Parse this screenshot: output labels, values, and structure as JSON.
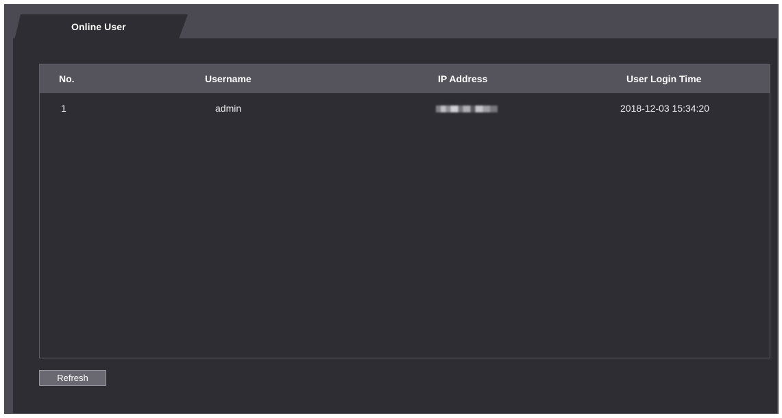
{
  "tab": {
    "label": "Online User"
  },
  "table": {
    "headers": {
      "no": "No.",
      "username": "Username",
      "ip": "IP Address",
      "login_time": "User Login Time"
    },
    "rows": [
      {
        "no": "1",
        "username": "admin",
        "ip": "",
        "login_time": "2018-12-03 15:34:20"
      }
    ]
  },
  "refresh_button": {
    "label": "Refresh"
  },
  "colors": {
    "frame": "#4b4952",
    "panel": "#2e2d33",
    "header": "#55535b",
    "button": "#6a6870"
  }
}
